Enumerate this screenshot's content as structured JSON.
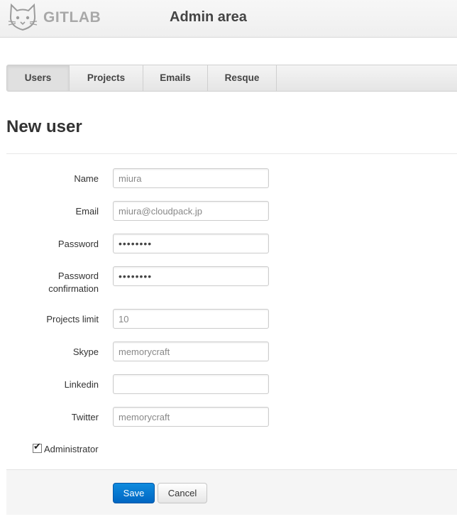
{
  "header": {
    "brand": "GITLAB",
    "title": "Admin area"
  },
  "tabs": [
    {
      "label": "Users",
      "active": true
    },
    {
      "label": "Projects",
      "active": false
    },
    {
      "label": "Emails",
      "active": false
    },
    {
      "label": "Resque",
      "active": false
    }
  ],
  "page_title": "New user",
  "form": {
    "name": {
      "label": "Name",
      "value": "miura"
    },
    "email": {
      "label": "Email",
      "value": "miura@cloudpack.jp"
    },
    "password": {
      "label": "Password",
      "value": "••••••••"
    },
    "password_confirmation": {
      "label_line1": "Password",
      "label_line2": "confirmation",
      "value": "••••••••"
    },
    "projects_limit": {
      "label": "Projects limit",
      "value": "10"
    },
    "skype": {
      "label": "Skype",
      "value": "memorycraft"
    },
    "linkedin": {
      "label": "Linkedin",
      "value": ""
    },
    "twitter": {
      "label": "Twitter",
      "value": "memorycraft"
    },
    "administrator": {
      "label": "Administrator",
      "checked": true
    }
  },
  "actions": {
    "save_label": "Save",
    "cancel_label": "Cancel"
  },
  "colors": {
    "primary_button": "#0073cf",
    "header_bg": "#f0f0f0"
  }
}
